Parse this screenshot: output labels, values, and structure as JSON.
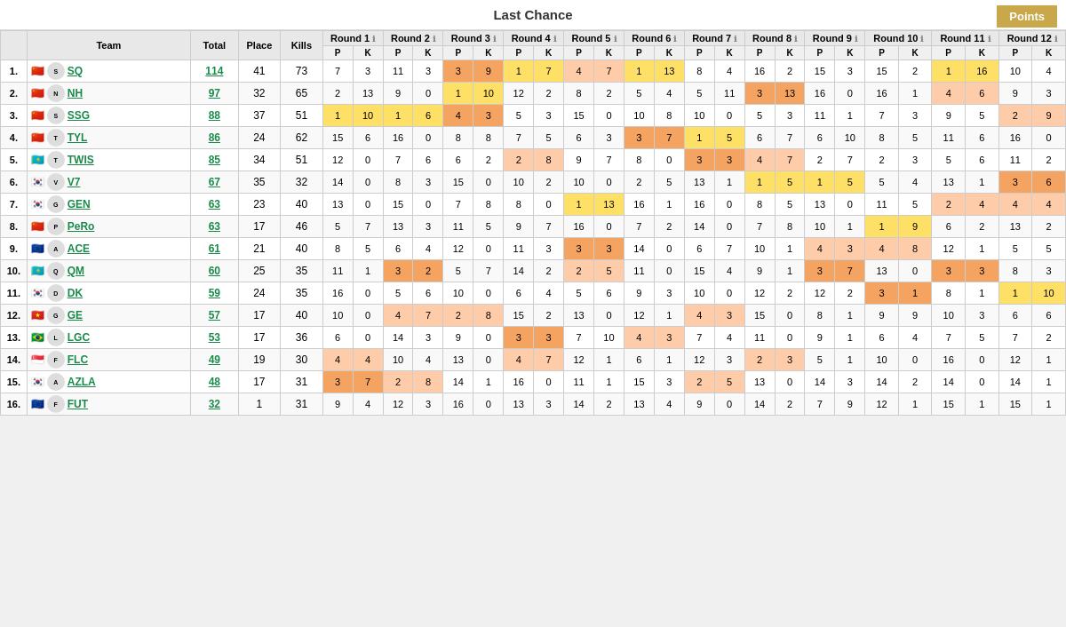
{
  "title": "Last Chance",
  "points_btn": "Points",
  "headers": {
    "rank": "#",
    "team": "Team",
    "total": "Total",
    "place": "Place",
    "kills": "Kills",
    "p": "P",
    "k": "K"
  },
  "rounds": [
    "Round 1",
    "Round 2",
    "Round 3",
    "Round 4",
    "Round 5",
    "Round 6",
    "Round 7",
    "Round 8",
    "Round 9",
    "Round 10",
    "Round 11",
    "Round 12"
  ],
  "teams": [
    {
      "rank": "1.",
      "flag": "🇨🇳",
      "logo": "SQ",
      "name": "SQ",
      "total": 114,
      "place": 41,
      "kills": 73,
      "rounds": [
        {
          "p": 7,
          "k": 3
        },
        {
          "p": 11,
          "k": 3
        },
        {
          "p": 3,
          "k": 9,
          "hp": "orange"
        },
        {
          "p": 1,
          "k": 7,
          "hp": "yellow"
        },
        {
          "p": 4,
          "k": 7,
          "hp": "peach"
        },
        {
          "p": 1,
          "k": 13,
          "hp": "yellow"
        },
        {
          "p": 8,
          "k": 4
        },
        {
          "p": 16,
          "k": 2
        },
        {
          "p": 15,
          "k": 3
        },
        {
          "p": 15,
          "k": 2
        },
        {
          "p": 1,
          "k": 16,
          "hp": "yellow"
        },
        {
          "p": 10,
          "k": 4
        }
      ]
    },
    {
      "rank": "2.",
      "flag": "🇨🇳",
      "logo": "NH",
      "name": "NH",
      "total": 97,
      "place": 32,
      "kills": 65,
      "rounds": [
        {
          "p": 2,
          "k": 13
        },
        {
          "p": 9,
          "k": 0
        },
        {
          "p": 1,
          "k": 10,
          "hp": "yellow"
        },
        {
          "p": 12,
          "k": 2
        },
        {
          "p": 8,
          "k": 2
        },
        {
          "p": 5,
          "k": 4
        },
        {
          "p": 5,
          "k": 11
        },
        {
          "p": 3,
          "k": 13,
          "hp": "orange"
        },
        {
          "p": 16,
          "k": 0
        },
        {
          "p": 16,
          "k": 1
        },
        {
          "p": 4,
          "k": 6,
          "hp": "peach"
        },
        {
          "p": 9,
          "k": 3
        }
      ]
    },
    {
      "rank": "3.",
      "flag": "🇨🇳",
      "logo": "SSG",
      "name": "SSG",
      "total": 88,
      "place": 37,
      "kills": 51,
      "rounds": [
        {
          "p": 1,
          "k": 10,
          "hp": "yellow"
        },
        {
          "p": 1,
          "k": 6,
          "hp": "yellow"
        },
        {
          "p": 4,
          "k": 3,
          "hp": "orange"
        },
        {
          "p": 5,
          "k": 3
        },
        {
          "p": 15,
          "k": 0
        },
        {
          "p": 10,
          "k": 8
        },
        {
          "p": 10,
          "k": 0
        },
        {
          "p": 5,
          "k": 3
        },
        {
          "p": 11,
          "k": 1
        },
        {
          "p": 7,
          "k": 3
        },
        {
          "p": 9,
          "k": 5
        },
        {
          "p": 2,
          "k": 9,
          "hp": "peach"
        }
      ]
    },
    {
      "rank": "4.",
      "flag": "🇨🇳",
      "logo": "TYL",
      "name": "TYL",
      "total": 86,
      "place": 24,
      "kills": 62,
      "rounds": [
        {
          "p": 15,
          "k": 6
        },
        {
          "p": 16,
          "k": 0
        },
        {
          "p": 8,
          "k": 8
        },
        {
          "p": 7,
          "k": 5
        },
        {
          "p": 6,
          "k": 3
        },
        {
          "p": 3,
          "k": 7,
          "hp": "orange"
        },
        {
          "p": 1,
          "k": 5,
          "hp": "yellow"
        },
        {
          "p": 6,
          "k": 7
        },
        {
          "p": 6,
          "k": 10
        },
        {
          "p": 8,
          "k": 5
        },
        {
          "p": 11,
          "k": 6
        },
        {
          "p": 16,
          "k": 0
        }
      ]
    },
    {
      "rank": "5.",
      "flag": "🇰🇿",
      "logo": "TWIS",
      "name": "TWIS",
      "total": 85,
      "place": 34,
      "kills": 51,
      "rounds": [
        {
          "p": 12,
          "k": 0
        },
        {
          "p": 7,
          "k": 6
        },
        {
          "p": 6,
          "k": 2
        },
        {
          "p": 2,
          "k": 8,
          "hp": "peach"
        },
        {
          "p": 9,
          "k": 7
        },
        {
          "p": 8,
          "k": 0
        },
        {
          "p": 3,
          "k": 3,
          "hp": "orange"
        },
        {
          "p": 4,
          "k": 7,
          "hp": "peach"
        },
        {
          "p": 2,
          "k": 7
        },
        {
          "p": 2,
          "k": 3
        },
        {
          "p": 5,
          "k": 6
        },
        {
          "p": 11,
          "k": 2
        }
      ]
    },
    {
      "rank": "6.",
      "flag": "🇰🇷",
      "logo": "V7",
      "name": "V7",
      "total": 67,
      "place": 35,
      "kills": 32,
      "rounds": [
        {
          "p": 14,
          "k": 0
        },
        {
          "p": 8,
          "k": 3
        },
        {
          "p": 15,
          "k": 0
        },
        {
          "p": 10,
          "k": 2
        },
        {
          "p": 10,
          "k": 0
        },
        {
          "p": 2,
          "k": 5
        },
        {
          "p": 13,
          "k": 1
        },
        {
          "p": 1,
          "k": 5,
          "hp": "yellow"
        },
        {
          "p": 1,
          "k": 5,
          "hp": "yellow"
        },
        {
          "p": 5,
          "k": 4
        },
        {
          "p": 13,
          "k": 1
        },
        {
          "p": 3,
          "k": 6,
          "hp": "orange"
        }
      ]
    },
    {
      "rank": "7.",
      "flag": "🇰🇷",
      "logo": "GEN",
      "name": "GEN",
      "total": 63,
      "place": 23,
      "kills": 40,
      "rounds": [
        {
          "p": 13,
          "k": 0
        },
        {
          "p": 15,
          "k": 0
        },
        {
          "p": 7,
          "k": 8
        },
        {
          "p": 8,
          "k": 0
        },
        {
          "p": 1,
          "k": 13,
          "hp": "yellow"
        },
        {
          "p": 16,
          "k": 1
        },
        {
          "p": 16,
          "k": 0
        },
        {
          "p": 8,
          "k": 5
        },
        {
          "p": 13,
          "k": 0
        },
        {
          "p": 11,
          "k": 5
        },
        {
          "p": 2,
          "k": 4,
          "hp": "peach"
        },
        {
          "p": 4,
          "k": 4,
          "hp": "peach"
        }
      ]
    },
    {
      "rank": "8.",
      "flag": "🇨🇳",
      "logo": "PeRo",
      "name": "PeRo",
      "total": 63,
      "place": 17,
      "kills": 46,
      "rounds": [
        {
          "p": 5,
          "k": 7
        },
        {
          "p": 13,
          "k": 3
        },
        {
          "p": 11,
          "k": 5
        },
        {
          "p": 9,
          "k": 7
        },
        {
          "p": 16,
          "k": 0
        },
        {
          "p": 7,
          "k": 2
        },
        {
          "p": 14,
          "k": 0
        },
        {
          "p": 7,
          "k": 8
        },
        {
          "p": 10,
          "k": 1
        },
        {
          "p": 1,
          "k": 9,
          "hp": "yellow"
        },
        {
          "p": 6,
          "k": 2
        },
        {
          "p": 13,
          "k": 2
        }
      ]
    },
    {
      "rank": "9.",
      "flag": "🇪🇺",
      "logo": "ACE",
      "name": "ACE",
      "total": 61,
      "place": 21,
      "kills": 40,
      "rounds": [
        {
          "p": 8,
          "k": 5
        },
        {
          "p": 6,
          "k": 4
        },
        {
          "p": 12,
          "k": 0
        },
        {
          "p": 11,
          "k": 3
        },
        {
          "p": 3,
          "k": 3,
          "hp": "orange"
        },
        {
          "p": 14,
          "k": 0
        },
        {
          "p": 6,
          "k": 7
        },
        {
          "p": 10,
          "k": 1
        },
        {
          "p": 4,
          "k": 3,
          "hp": "peach"
        },
        {
          "p": 4,
          "k": 8,
          "hp": "peach"
        },
        {
          "p": 12,
          "k": 1
        },
        {
          "p": 5,
          "k": 5
        }
      ]
    },
    {
      "rank": "10.",
      "flag": "🇰🇿",
      "logo": "QM",
      "name": "QM",
      "total": 60,
      "place": 25,
      "kills": 35,
      "rounds": [
        {
          "p": 11,
          "k": 1
        },
        {
          "p": 3,
          "k": 2,
          "hp": "orange"
        },
        {
          "p": 5,
          "k": 7
        },
        {
          "p": 14,
          "k": 2
        },
        {
          "p": 2,
          "k": 5,
          "hp": "peach"
        },
        {
          "p": 11,
          "k": 0
        },
        {
          "p": 15,
          "k": 4
        },
        {
          "p": 9,
          "k": 1
        },
        {
          "p": 3,
          "k": 7,
          "hp": "orange"
        },
        {
          "p": 13,
          "k": 0
        },
        {
          "p": 3,
          "k": 3,
          "hp": "orange"
        },
        {
          "p": 8,
          "k": 3
        }
      ]
    },
    {
      "rank": "11.",
      "flag": "🇰🇷",
      "logo": "DK",
      "name": "DK",
      "total": 59,
      "place": 24,
      "kills": 35,
      "rounds": [
        {
          "p": 16,
          "k": 0
        },
        {
          "p": 5,
          "k": 6
        },
        {
          "p": 10,
          "k": 0
        },
        {
          "p": 6,
          "k": 4
        },
        {
          "p": 5,
          "k": 6
        },
        {
          "p": 9,
          "k": 3
        },
        {
          "p": 10,
          "k": 0
        },
        {
          "p": 12,
          "k": 2
        },
        {
          "p": 12,
          "k": 2
        },
        {
          "p": 3,
          "k": 1,
          "hp": "orange"
        },
        {
          "p": 8,
          "k": 1
        },
        {
          "p": 1,
          "k": 10,
          "hp": "yellow"
        }
      ]
    },
    {
      "rank": "12.",
      "flag": "🇻🇳",
      "logo": "GE",
      "name": "GE",
      "total": 57,
      "place": 17,
      "kills": 40,
      "rounds": [
        {
          "p": 10,
          "k": 0
        },
        {
          "p": 4,
          "k": 7,
          "hp": "peach"
        },
        {
          "p": 2,
          "k": 8,
          "hp": "peach"
        },
        {
          "p": 15,
          "k": 2
        },
        {
          "p": 13,
          "k": 0
        },
        {
          "p": 12,
          "k": 1
        },
        {
          "p": 4,
          "k": 3,
          "hp": "peach"
        },
        {
          "p": 15,
          "k": 0
        },
        {
          "p": 8,
          "k": 1
        },
        {
          "p": 9,
          "k": 9
        },
        {
          "p": 10,
          "k": 3
        },
        {
          "p": 6,
          "k": 6
        }
      ]
    },
    {
      "rank": "13.",
      "flag": "🇧🇷",
      "logo": "LGC",
      "name": "LGC",
      "total": 53,
      "place": 17,
      "kills": 36,
      "rounds": [
        {
          "p": 6,
          "k": 0
        },
        {
          "p": 14,
          "k": 3
        },
        {
          "p": 9,
          "k": 0
        },
        {
          "p": 3,
          "k": 3,
          "hp": "orange"
        },
        {
          "p": 7,
          "k": 10
        },
        {
          "p": 4,
          "k": 3,
          "hp": "peach"
        },
        {
          "p": 7,
          "k": 4
        },
        {
          "p": 11,
          "k": 0
        },
        {
          "p": 9,
          "k": 1
        },
        {
          "p": 6,
          "k": 4
        },
        {
          "p": 7,
          "k": 5
        },
        {
          "p": 7,
          "k": 2
        }
      ]
    },
    {
      "rank": "14.",
      "flag": "🇸🇬",
      "logo": "FLC",
      "name": "FLC",
      "total": 49,
      "place": 19,
      "kills": 30,
      "rounds": [
        {
          "p": 4,
          "k": 4,
          "hp": "peach"
        },
        {
          "p": 10,
          "k": 4
        },
        {
          "p": 13,
          "k": 0
        },
        {
          "p": 4,
          "k": 7,
          "hp": "peach"
        },
        {
          "p": 12,
          "k": 1
        },
        {
          "p": 6,
          "k": 1
        },
        {
          "p": 12,
          "k": 3
        },
        {
          "p": 2,
          "k": 3,
          "hp": "peach"
        },
        {
          "p": 5,
          "k": 1
        },
        {
          "p": 10,
          "k": 0
        },
        {
          "p": 16,
          "k": 0
        },
        {
          "p": 12,
          "k": 1
        }
      ]
    },
    {
      "rank": "15.",
      "flag": "🇰🇷",
      "logo": "AZLA",
      "name": "AZLA",
      "total": 48,
      "place": 17,
      "kills": 31,
      "rounds": [
        {
          "p": 3,
          "k": 7,
          "hp": "orange"
        },
        {
          "p": 2,
          "k": 8,
          "hp": "peach"
        },
        {
          "p": 14,
          "k": 1
        },
        {
          "p": 16,
          "k": 0
        },
        {
          "p": 11,
          "k": 1
        },
        {
          "p": 15,
          "k": 3
        },
        {
          "p": 2,
          "k": 5,
          "hp": "peach"
        },
        {
          "p": 13,
          "k": 0
        },
        {
          "p": 14,
          "k": 3
        },
        {
          "p": 14,
          "k": 2
        },
        {
          "p": 14,
          "k": 0
        },
        {
          "p": 14,
          "k": 1
        }
      ]
    },
    {
      "rank": "16.",
      "flag": "🇪🇺",
      "logo": "FUT",
      "name": "FUT",
      "total": 32,
      "place": 1,
      "kills": 31,
      "rounds": [
        {
          "p": 9,
          "k": 4
        },
        {
          "p": 12,
          "k": 3
        },
        {
          "p": 16,
          "k": 0
        },
        {
          "p": 13,
          "k": 3
        },
        {
          "p": 14,
          "k": 2
        },
        {
          "p": 13,
          "k": 4
        },
        {
          "p": 9,
          "k": 0
        },
        {
          "p": 14,
          "k": 2
        },
        {
          "p": 7,
          "k": 9
        },
        {
          "p": 12,
          "k": 1
        },
        {
          "p": 15,
          "k": 1
        },
        {
          "p": 15,
          "k": 1
        }
      ]
    }
  ]
}
